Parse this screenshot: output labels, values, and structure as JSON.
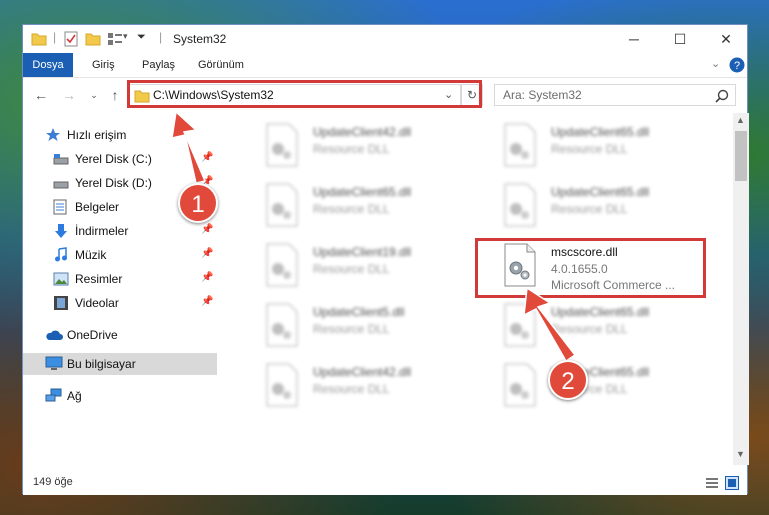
{
  "window": {
    "title": "System32"
  },
  "ribbon": {
    "tabs": [
      "Dosya",
      "Giriş",
      "Paylaş",
      "Görünüm"
    ]
  },
  "address": {
    "path": "C:\\Windows\\System32"
  },
  "search": {
    "placeholder": "Ara: System32"
  },
  "sidebar": {
    "items": [
      {
        "label": "Hızlı erişim",
        "icon": "star-icon",
        "pinned": false
      },
      {
        "label": "Yerel Disk (C:)",
        "icon": "drive-icon",
        "pinned": true
      },
      {
        "label": "Yerel Disk (D:)",
        "icon": "drive-icon",
        "pinned": true
      },
      {
        "label": "Belgeler",
        "icon": "document-icon",
        "pinned": true
      },
      {
        "label": "İndirmeler",
        "icon": "download-icon",
        "pinned": true
      },
      {
        "label": "Müzik",
        "icon": "music-icon",
        "pinned": true
      },
      {
        "label": "Resimler",
        "icon": "pictures-icon",
        "pinned": true
      },
      {
        "label": "Videolar",
        "icon": "video-icon",
        "pinned": true
      },
      {
        "label": "OneDrive",
        "icon": "cloud-icon",
        "pinned": false
      },
      {
        "label": "Bu bilgisayar",
        "icon": "computer-icon",
        "pinned": false
      },
      {
        "label": "Ağ",
        "icon": "network-icon",
        "pinned": false
      }
    ]
  },
  "files": [
    {
      "name": "UpdateClient42.dll",
      "line1": "Resource DLL",
      "line2": ""
    },
    {
      "name": "UpdateClient65.dll",
      "line1": "Resource DLL",
      "line2": ""
    },
    {
      "name": "UpdateClient65.dll",
      "line1": "Resource DLL",
      "line2": ""
    },
    {
      "name": "UpdateClient65.dll",
      "line1": "Resource DLL",
      "line2": ""
    },
    {
      "name": "UpdateClient19.dll",
      "line1": "Resource DLL",
      "line2": ""
    },
    {
      "name": "mscscore.dll",
      "line1": "4.0.1655.0",
      "line2": "Microsoft Commerce ..."
    },
    {
      "name": "UpdateClient5.dll",
      "line1": "Resource DLL",
      "line2": ""
    },
    {
      "name": "UpdateClient65.dll",
      "line1": "Resource DLL",
      "line2": ""
    },
    {
      "name": "UpdateClient42.dll",
      "line1": "Resource DLL",
      "line2": ""
    },
    {
      "name": "UpdateClient65.dll",
      "line1": "Resource DLL",
      "line2": ""
    }
  ],
  "status": {
    "count": "149 öğe"
  },
  "annotations": {
    "step1": "1",
    "step2": "2"
  },
  "colors": {
    "accent": "#1a5fb4",
    "highlight": "#d23a3a",
    "badge": "#e14a3b"
  }
}
